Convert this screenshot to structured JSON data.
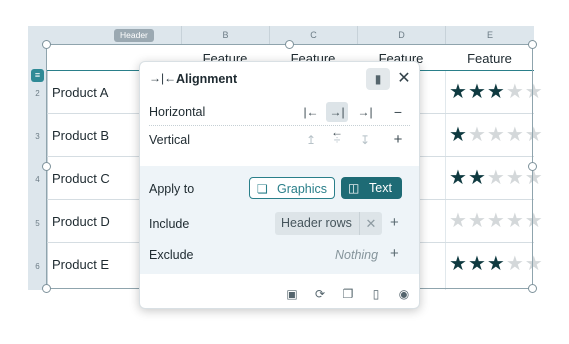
{
  "sheet": {
    "col_headers": [
      "Header",
      "B",
      "C",
      "D",
      "E"
    ],
    "header_cells": [
      "Feature",
      "Feature",
      "Feature"
    ],
    "rows": [
      {
        "num": "2",
        "product": "Product A",
        "stars": 3
      },
      {
        "num": "3",
        "product": "Product B",
        "stars": 1
      },
      {
        "num": "4",
        "product": "Product C",
        "stars": 2
      },
      {
        "num": "5",
        "product": "Product D",
        "stars": 0
      },
      {
        "num": "6",
        "product": "Product E",
        "stars": 3
      }
    ],
    "max_stars": 5,
    "row_handle_icon": "row-handle-icon"
  },
  "popup": {
    "title": "Alignment",
    "title_icon": "align-center-icon",
    "horizontal_label": "Horizontal",
    "vertical_label": "Vertical",
    "apply_label": "Apply to",
    "graphics_label": "Graphics",
    "text_label": "Text",
    "include_label": "Include",
    "include_chip": "Header rows",
    "exclude_label": "Exclude",
    "exclude_value": "Nothing",
    "pin_icon": "pin-icon",
    "close_icon": "close-icon",
    "footer_icons": [
      "save-icon",
      "refresh-icon",
      "copy-icon",
      "delete-icon",
      "preview-icon"
    ]
  },
  "colors": {
    "accent": "#2a7f8a",
    "accent_dark": "#1e6b75",
    "star_on": "#0f3a40",
    "star_off": "#d4d8da",
    "section_bg": "#eef4f8"
  }
}
